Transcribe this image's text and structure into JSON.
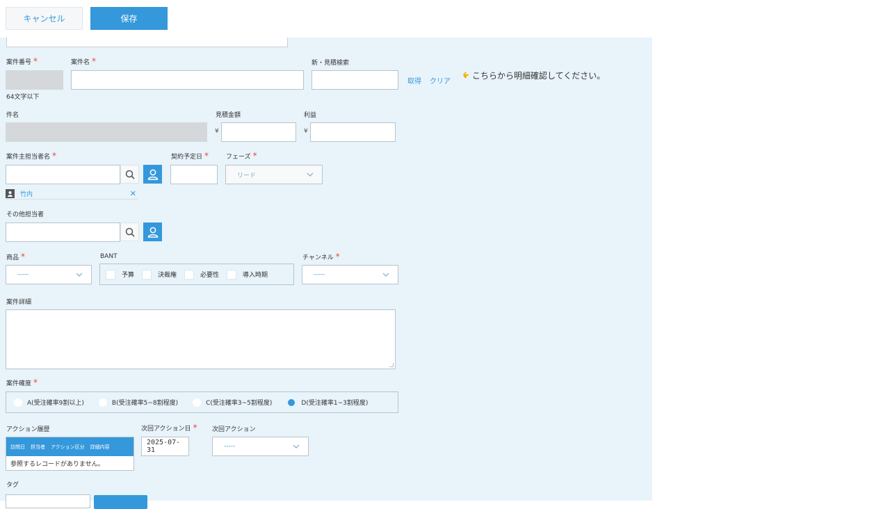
{
  "toolbar": {
    "cancel_label": "キャンセル",
    "save_label": "保存"
  },
  "form": {
    "case_no_label": "案件番号",
    "case_no_hint": "64文字以下",
    "case_name_label": "案件名",
    "estimate_search_label": "新・見積検索",
    "get_link": "取得",
    "clear_link": "クリア",
    "hint_text": "こちらから明細確認してください。",
    "subject_label": "件名",
    "estimate_amount_label": "見積金額",
    "profit_label": "利益",
    "yen_symbol": "¥",
    "owner_label": "案件主担当者名",
    "contract_date_label": "契約予定日",
    "phase_label": "フェーズ",
    "phase_value": "リード",
    "owner_user_name": "竹内",
    "other_owner_label": "その他担当者",
    "product_label": "商品",
    "product_value": "-----",
    "bant_label": "BANT",
    "bant_items": [
      "予算",
      "決裁権",
      "必要性",
      "導入時期"
    ],
    "channel_label": "チャンネル",
    "channel_value": "-----",
    "detail_label": "案件詳細",
    "certainty_label": "案件確度",
    "certainty_options": [
      "A(受注確率9割以上)",
      "B(受注確率5~8割程度)",
      "C(受注確率3~5割程度)",
      "D(受注確率1~3割程度)"
    ],
    "certainty_selected": "D(受注確率1~3割程度)",
    "action_history_label": "アクション履歴",
    "action_columns": [
      "訪問日",
      "担当者",
      "アクション区分",
      "詳細内容"
    ],
    "action_empty": "参照するレコードがありません。",
    "next_action_date_label": "次回アクション日",
    "next_action_date_value": "2025-07-31",
    "next_action_label": "次回アクション",
    "next_action_value": "-----",
    "tag_label": "タグ"
  },
  "colors": {
    "accent": "#3498db",
    "form_bg": "#e8f3fa",
    "required": "#e74c3c"
  }
}
